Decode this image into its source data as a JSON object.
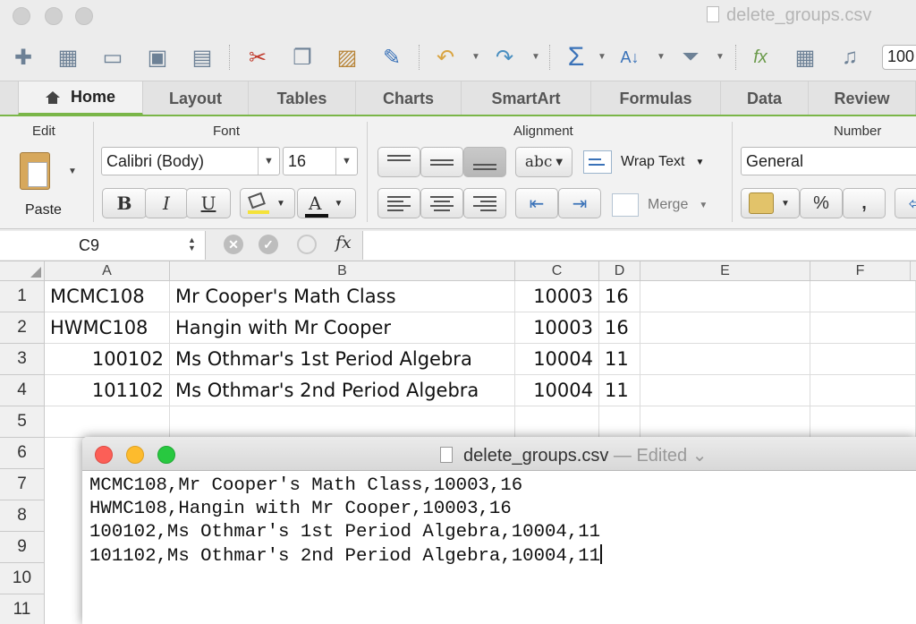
{
  "window": {
    "title": "delete_groups.csv"
  },
  "toolbar": {
    "zoom": "100"
  },
  "tabs": [
    "Home",
    "Layout",
    "Tables",
    "Charts",
    "SmartArt",
    "Formulas",
    "Data",
    "Review"
  ],
  "ribbon": {
    "groups": {
      "edit": "Edit",
      "font": "Font",
      "alignment": "Alignment",
      "number": "Number"
    },
    "paste_label": "Paste",
    "font_name": "Calibri (Body)",
    "font_size": "16",
    "bold": "B",
    "italic": "I",
    "underline": "U",
    "font_color_glyph": "A",
    "abc": "abc",
    "wrap_text": "Wrap Text",
    "merge": "Merge",
    "number_format": "General",
    "percent": "%",
    "comma": ","
  },
  "formula_bar": {
    "name_box": "C9",
    "fx": "fx",
    "cancel": "✕",
    "confirm": "✓"
  },
  "sheet": {
    "columns": [
      "A",
      "B",
      "C",
      "D",
      "E",
      "F"
    ],
    "rows": [
      "1",
      "2",
      "3",
      "4",
      "5",
      "6",
      "7",
      "8",
      "9",
      "10",
      "11"
    ],
    "data": [
      [
        "MCMC108",
        "Mr Cooper's Math Class",
        "10003",
        "16"
      ],
      [
        "HWMC108",
        "Hangin with Mr Cooper",
        "10003",
        "16"
      ],
      [
        "100102",
        "Ms Othmar's 1st Period Algebra",
        "10004",
        "11"
      ],
      [
        "101102",
        "Ms Othmar's 2nd Period Algebra",
        "10004",
        "11"
      ]
    ]
  },
  "textedit": {
    "filename": "delete_groups.csv",
    "status": "— Edited ⌄",
    "lines": [
      "MCMC108,Mr Cooper's Math Class,10003,16",
      "HWMC108,Hangin with Mr Cooper,10003,16",
      "100102,Ms Othmar's 1st Period Algebra,10004,11",
      "101102,Ms Othmar's 2nd Period Algebra,10004,11"
    ]
  },
  "colors": {
    "accent_green": "#7ab648",
    "close": "#fc5f57",
    "minimize": "#fdbb2d",
    "zoom": "#28c840"
  },
  "icons": [
    "new-icon",
    "gallery-icon",
    "open-icon",
    "save-icon",
    "print-icon",
    "cut-icon",
    "copy-icon",
    "paste-icon",
    "format-painter-icon",
    "undo-icon",
    "redo-icon",
    "autosum-icon",
    "sort-icon",
    "filter-icon",
    "function-icon",
    "toolbox-icon",
    "media-icon"
  ]
}
